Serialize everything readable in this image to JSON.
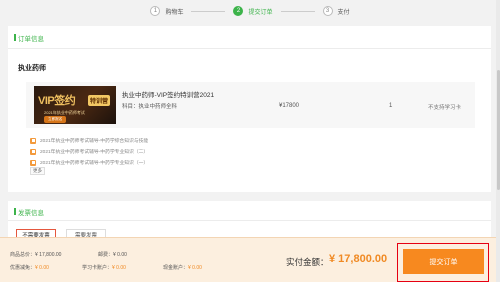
{
  "steps": [
    {
      "num": "1",
      "label": "购物车"
    },
    {
      "num": "2",
      "label": "提交订单"
    },
    {
      "num": "3",
      "label": "支付"
    }
  ],
  "order": {
    "section_title": "订单信息",
    "product_name": "执业药师",
    "thumb": {
      "big": "VIP签约",
      "tag": "特训营",
      "sub": "2021年执业中药师考试",
      "btn": "立即报名"
    },
    "course_title": "执业中药师-VIP签约特训营2021",
    "course_subject": "科目：执业中药师全科",
    "price": "¥17800",
    "quantity": "1",
    "card_note": "不支持学习卡",
    "bonuses": [
      "2021年执业中药师考试辅导-中药学综合知识与技能",
      "2021年执业中药师考试辅导-中药学专业知识（二）",
      "2021年执业中药师考试辅导-中药学专业知识（一）"
    ],
    "bonus_tag": "更多"
  },
  "invoice": {
    "section_title": "发票信息",
    "options": [
      "不需要发票",
      "需要发票"
    ]
  },
  "summary": {
    "goods_total_label": "商品总价：",
    "goods_total": "¥ 17,800.00",
    "shipping_label": "邮费：",
    "shipping": "¥ 0.00",
    "coupon_label": "优惠减免：",
    "coupon": "¥ 0.00",
    "study_card_label": "学习卡账户：",
    "study_card": "¥ 0.00",
    "cash_label": "现金账户：",
    "cash": "¥ 0.00",
    "pay_label": "实付金额：",
    "pay_amount": "¥ 17,800.00",
    "submit_label": "提交订单"
  },
  "colors": {
    "accent_green": "#3cb34a",
    "accent_orange": "#f7891f",
    "highlight_red": "#e60012"
  }
}
